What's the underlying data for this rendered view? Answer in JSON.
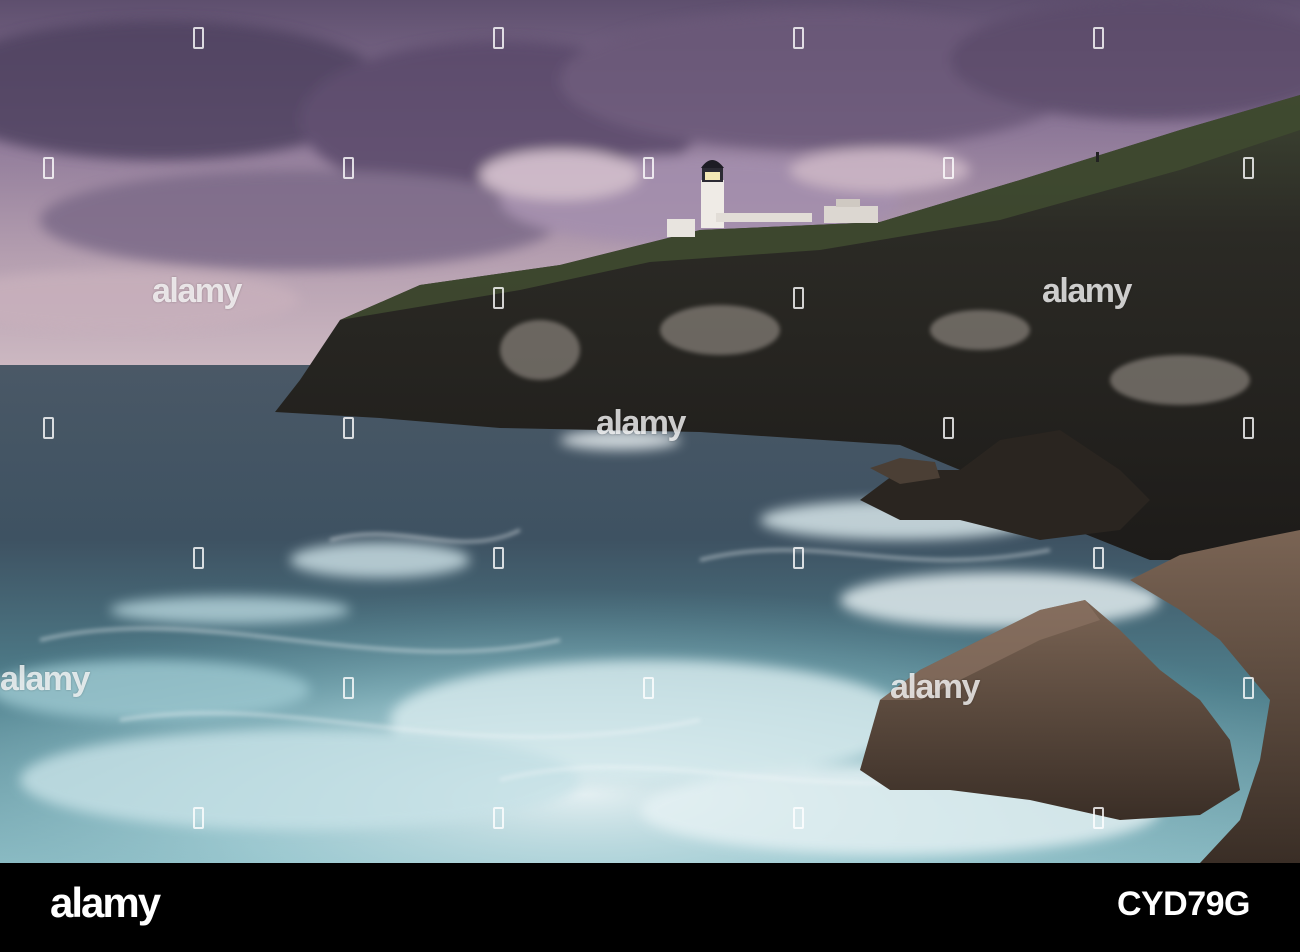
{
  "photo": {
    "subject": "lighthouse-on-sea-cliff",
    "colors": {
      "sky_top": "#6b5a78",
      "sky_mid": "#9c86a6",
      "sky_horizon": "#c9b2be",
      "sea_dark": "#3c4a57",
      "sea_turquoise": "#7fb4bf",
      "foam": "#eef4f6",
      "cliff": "#2a2622",
      "rock_warm": "#6b5646"
    }
  },
  "watermark": {
    "text": "alamy",
    "icon": "alamy-a-icon"
  },
  "footer": {
    "brand": "alamy",
    "stock_id": "CYD79G"
  }
}
